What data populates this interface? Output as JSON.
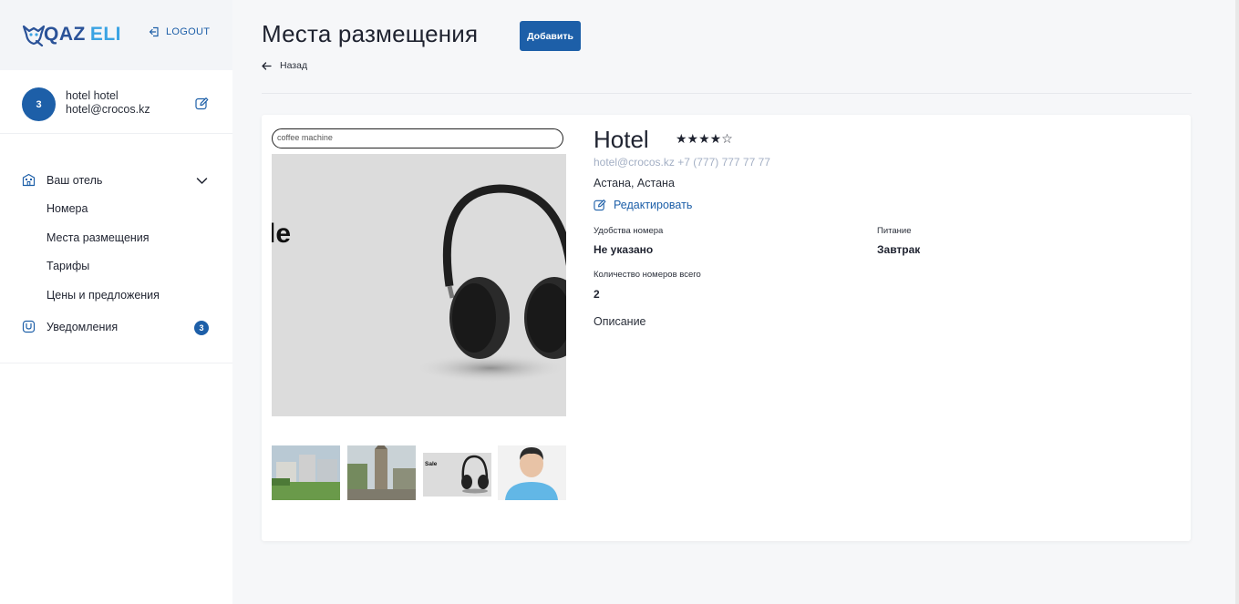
{
  "sidebar": {
    "logo": {
      "q": "QAZ",
      "eli": "ELI"
    },
    "logout_label": "LOGOUT",
    "user": {
      "avatar_text": "3",
      "name": "hotel hotel",
      "email": "hotel@crocos.kz"
    },
    "nav": {
      "hotel_label": "Ваш отель",
      "subitems": [
        "Номера",
        "Места размещения",
        "Тарифы",
        "Цены и предложения"
      ],
      "notifications_label": "Уведомления",
      "notifications_count": "3"
    }
  },
  "main": {
    "title": "Места размещения",
    "add_button": "Добавить",
    "back_label": "Назад",
    "hotel": {
      "name": "Hotel",
      "stars": "★★★★☆",
      "rating": 4,
      "contact": "hotel@crocos.kz +7 (777) 777 77 77",
      "city": "Астана, Астана",
      "edit_label": "Редактировать",
      "photo_search_text": "coffee machine",
      "photo_sale_text": "le",
      "thumb_sale_text": "Sale",
      "fields": {
        "amenities_label": "Удобства номера",
        "amenities_value": "Не указано",
        "meals_label": "Питание",
        "meals_value": "Завтрак",
        "rooms_label": "Количество номеров всего",
        "rooms_value": "2"
      },
      "description_label": "Описание"
    }
  },
  "colors": {
    "brand": "#1d5fa8",
    "logo_dark": "#2a5298",
    "logo_light": "#3aa3e3",
    "muted": "#a3afc4"
  }
}
